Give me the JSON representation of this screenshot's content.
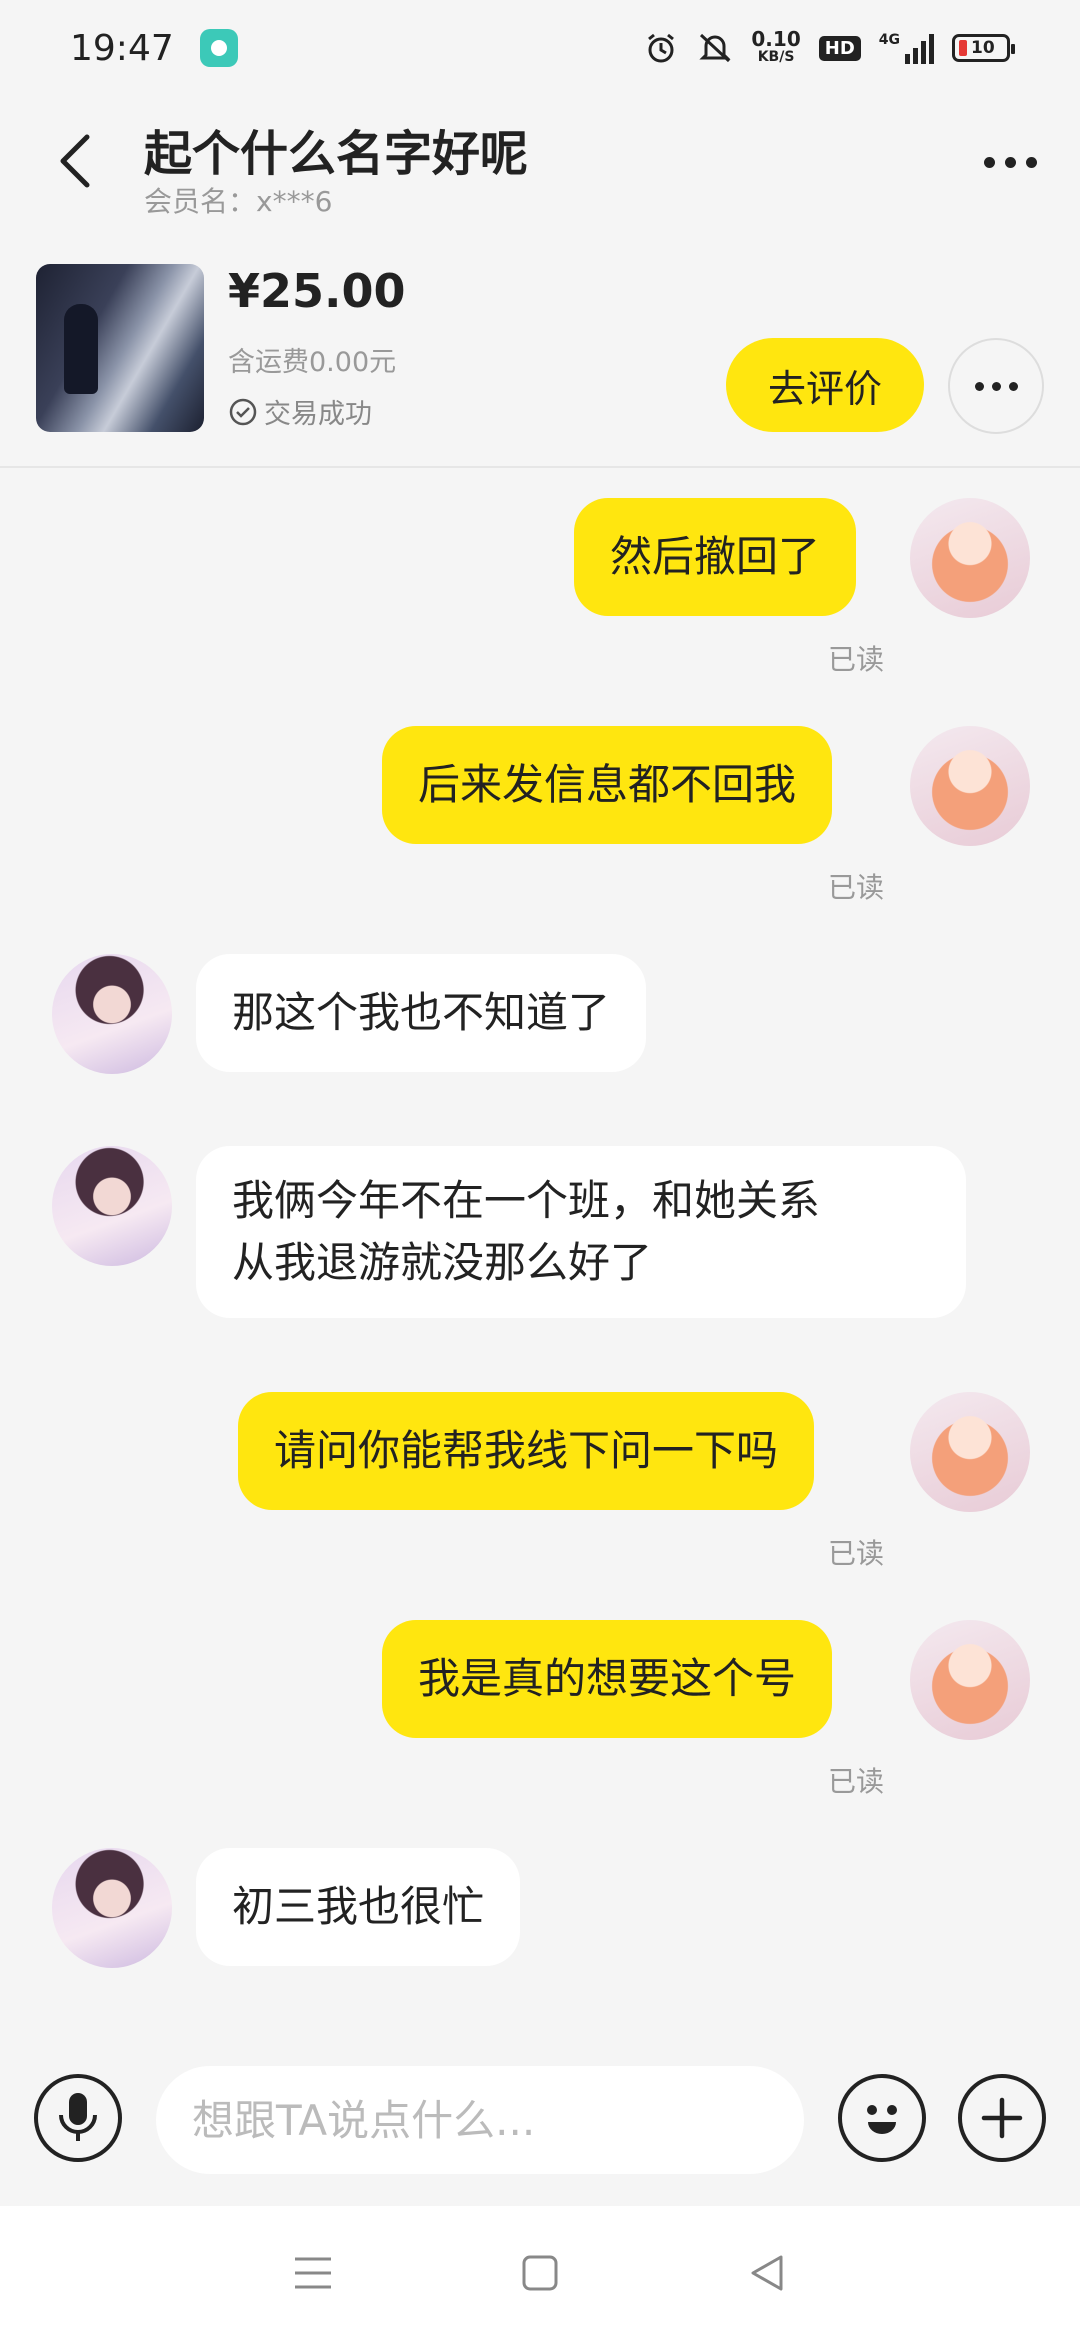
{
  "status_bar": {
    "time": "19:47",
    "net_speed_value": "0.10",
    "net_speed_unit": "KB/S",
    "hd_label": "HD",
    "network_label": "4G",
    "battery_level": "10",
    "icons": [
      "app-notification-icon",
      "alarm-icon",
      "mute-icon",
      "hd-icon",
      "signal-icon",
      "battery-icon"
    ]
  },
  "header": {
    "title": "起个什么名字好呢",
    "subtitle": "会员名：x***6"
  },
  "product": {
    "price": "¥25.00",
    "shipping": "含运费0.00元",
    "status": "交易成功",
    "review_button": "去评价"
  },
  "messages": [
    {
      "side": "me",
      "text": "然后撤回了",
      "read": "已读"
    },
    {
      "side": "me",
      "text": "后来发信息都不回我",
      "read": "已读"
    },
    {
      "side": "them",
      "text": "那这个我也不知道了"
    },
    {
      "side": "them",
      "text_line1": "我俩今年不在一个班，和她关系",
      "text_line2": "从我退游就没那么好了"
    },
    {
      "side": "me",
      "text": "请问你能帮我线下问一下吗",
      "read": "已读"
    },
    {
      "side": "me",
      "text": "我是真的想要这个号",
      "read": "已读"
    },
    {
      "side": "them",
      "text": "初三我也很忙"
    }
  ],
  "input_bar": {
    "placeholder": "想跟TA说点什么..."
  },
  "colors": {
    "accent": "#ffe60f",
    "background": "#f5f5f5",
    "battery_low": "#e53935"
  }
}
